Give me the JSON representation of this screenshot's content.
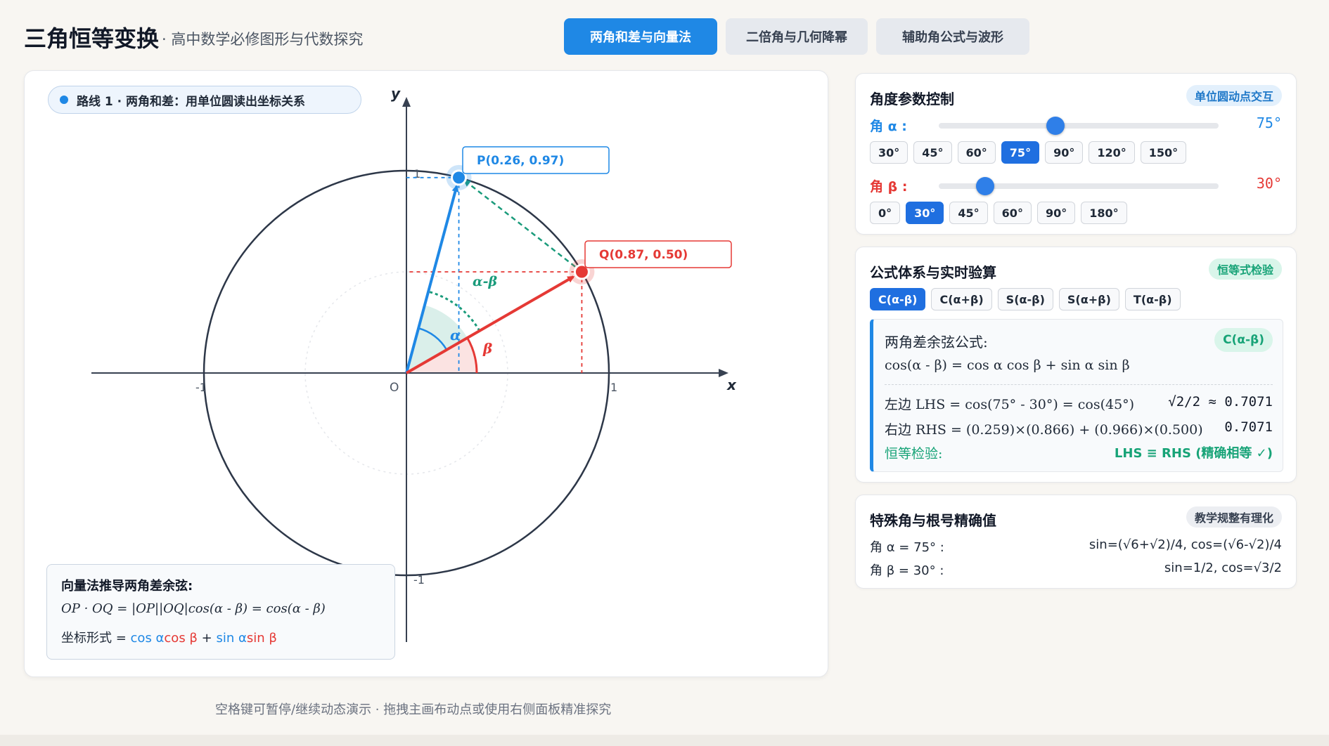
{
  "header": {
    "title": "三角恒等变换",
    "subtitle": "· 高中数学必修图形与代数探究",
    "tabs": [
      {
        "label": "两角和差与向量法",
        "active": true
      },
      {
        "label": "二倍角与几何降幂",
        "active": false
      },
      {
        "label": "辅助角公式与波形",
        "active": false
      }
    ]
  },
  "canvas": {
    "route_label": "路线 1 · 两角和差：用单位圆读出坐标关系",
    "axis_x": "x",
    "axis_y": "y",
    "origin": "O",
    "tick_pos_x": "1",
    "tick_neg_x": "-1",
    "tick_pos_y": "1",
    "tick_neg_y": "-1",
    "point_p_label": "P(0.26, 0.97)",
    "point_q_label": "Q(0.87, 0.50)",
    "angle_alpha": "α",
    "angle_beta": "β",
    "angle_diff": "α-β",
    "alpha_deg": 75,
    "beta_deg": 30,
    "colors": {
      "p": "#1f88e5",
      "q": "#e53935",
      "diff": "#1a9b7b"
    },
    "derivation": {
      "title": "向量法推导两角差余弦:",
      "line1": "OP · OQ = |OP||OQ|cos(α - β) = cos(α - β)",
      "line2_prefix": "坐标形式 = ",
      "line2_t1": "cos α",
      "line2_t2": "cos β",
      "line2_plus": " + ",
      "line2_t3": "sin α",
      "line2_t4": "sin β"
    }
  },
  "footer": {
    "hint": "空格键可暂停/继续动态演示 · 拖拽主画布动点或使用右侧面板精准探究"
  },
  "param_panel": {
    "title": "角度参数控制",
    "badge": "单位圆动点交互",
    "alpha": {
      "label": "角 α :",
      "value": "75°",
      "level": 0.4167,
      "presets": [
        {
          "label": "30°",
          "active": false
        },
        {
          "label": "45°",
          "active": false
        },
        {
          "label": "60°",
          "active": false
        },
        {
          "label": "75°",
          "active": true
        },
        {
          "label": "90°",
          "active": false
        },
        {
          "label": "120°",
          "active": false
        },
        {
          "label": "150°",
          "active": false
        }
      ]
    },
    "beta": {
      "label": "角 β :",
      "value": "30°",
      "level": 0.1667,
      "presets": [
        {
          "label": "0°",
          "active": false
        },
        {
          "label": "30°",
          "active": true
        },
        {
          "label": "45°",
          "active": false
        },
        {
          "label": "60°",
          "active": false
        },
        {
          "label": "90°",
          "active": false
        },
        {
          "label": "180°",
          "active": false
        }
      ]
    }
  },
  "formula_panel": {
    "title": "公式体系与实时验算",
    "badge": "恒等式检验",
    "tabs": [
      {
        "label": "C(α-β)",
        "active": true
      },
      {
        "label": "C(α+β)",
        "active": false
      },
      {
        "label": "S(α-β)",
        "active": false
      },
      {
        "label": "S(α+β)",
        "active": false
      },
      {
        "label": "T(α-β)",
        "active": false
      }
    ],
    "box": {
      "title": "两角差余弦公式:",
      "badge": "C(α-β)",
      "equation": "cos(α - β) = cos α cos β + sin α sin β",
      "lhs_label": "左边 LHS = cos(75° - 30°) = cos(45°)",
      "lhs_value": "√2/2 ≈ 0.7071",
      "rhs_label": "右边 RHS = (0.259)×(0.866) + (0.966)×(0.500)",
      "rhs_value": "0.7071",
      "check_label": "恒等检验:",
      "check_value": "LHS ≡ RHS (精确相等 ✓)"
    }
  },
  "special_panel": {
    "title": "特殊角与根号精确值",
    "badge": "教学规整有理化",
    "rows": [
      {
        "label": "角 α = 75° :",
        "value": "sin=(√6+√2)/4, cos=(√6-√2)/4"
      },
      {
        "label": "角 β = 30° :",
        "value": "sin=1/2, cos=√3/2"
      }
    ]
  }
}
